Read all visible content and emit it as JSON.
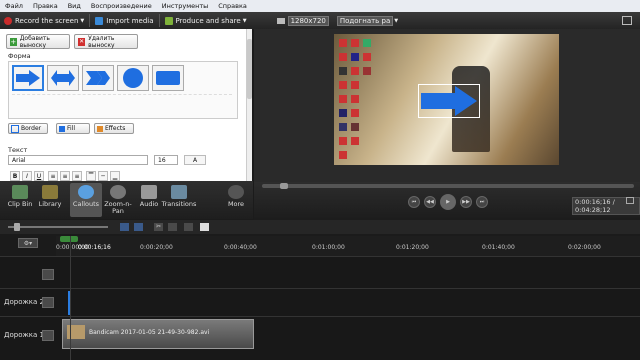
{
  "menu": [
    "Файл",
    "Правка",
    "Вид",
    "Воспроизведение",
    "Инструменты",
    "Справка"
  ],
  "toolbar": {
    "record": "Record the screen",
    "import": "Import media",
    "produce": "Produce and share",
    "resolution": "1280x720",
    "fit": "Подогнать ра"
  },
  "callouts": {
    "add_label": "Добавить выноску",
    "remove_label": "Удалить выноску",
    "shape_header": "Форма",
    "border_label": "Border",
    "fill_label": "Fill",
    "effects_label": "Effects",
    "text_header": "Текст",
    "font": "Arial",
    "size": "16",
    "bold": "B",
    "italic": "I",
    "underline": "U",
    "color_label": "A"
  },
  "tabs": [
    "Clip Bin",
    "Library",
    "Callouts",
    "Zoom-n-Pan",
    "Audio",
    "Transitions",
    "More"
  ],
  "player": {
    "time": "0:00:16;16 / 0:04:28;12"
  },
  "timeline": {
    "playhead": "0:00:16;16",
    "ticks": [
      "0:00:00;00",
      "0:00:20;00",
      "0:00:40;00",
      "0:01:00;00",
      "0:01:20;00",
      "0:01:40;00",
      "0:02:00;00"
    ],
    "tracks": [
      {
        "label": ""
      },
      {
        "label": "Дорожка 2"
      },
      {
        "label": "Дорожка 1",
        "clip": "Bandicam 2017-01-05 21-49-30-982.avi"
      }
    ]
  },
  "colors": {
    "accent": "#2a7de1",
    "callout_fill": "#1f6ee0",
    "selection": "#1a5fd6"
  }
}
